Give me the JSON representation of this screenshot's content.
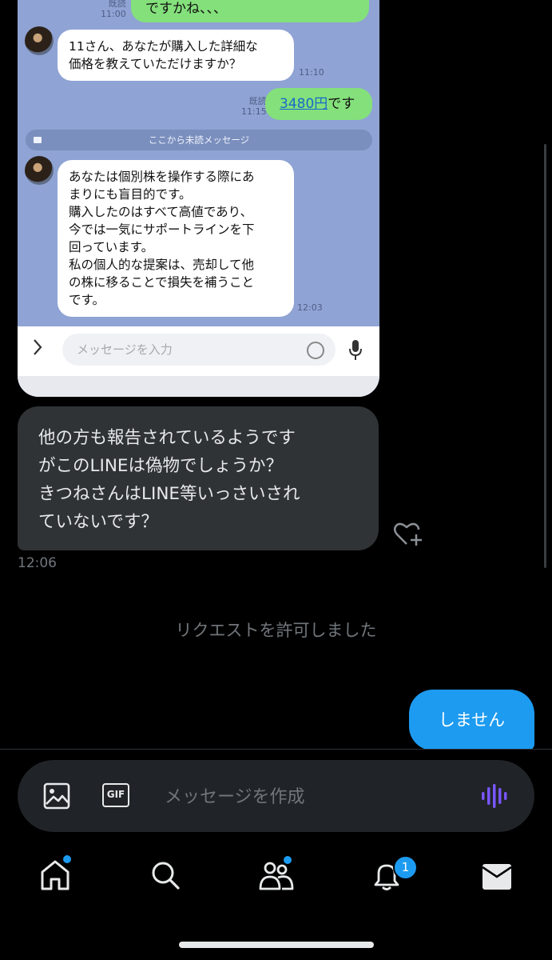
{
  "line_screenshot": {
    "top_bubble": "ですかね、、、",
    "top_read": "既読",
    "top_time": "11:00",
    "question_bubble": [
      "11さん、あなたが購入した詳細な",
      "価格を教えていただけますか？"
    ],
    "question_time": "11:10",
    "reply_read": "既読",
    "reply_time": "11:15",
    "reply_link": "3480円",
    "reply_suffix": "です",
    "unread_divider": "ここから未読メッセージ",
    "advice_bubble": [
      "あなたは個別株を操作する際にあ",
      "まりにも盲目的です。",
      "購入したのはすべて高値であり、",
      "今では一気にサポートラインを下",
      "回っています。",
      "私の個人的な提案は、売却して他",
      "の株に移ることで損失を補うこと",
      "です。"
    ],
    "advice_time": "12:03",
    "input_placeholder": "メッセージを入力"
  },
  "dm": {
    "received_lines": [
      "他の方も報告されているようです",
      "がこのLINEは偽物でしょうか？",
      "きつねさんはLINE等いっさいされ",
      "ていないです？"
    ],
    "received_time": "12:06",
    "system_note": "リクエストを許可しました",
    "sent_message": "しません"
  },
  "composer": {
    "placeholder": "メッセージを作成",
    "gif_label": "GIF"
  },
  "nav": {
    "notifications_badge": "1"
  },
  "colors": {
    "accent": "#1d9bf0",
    "bubble_dark": "#2f3336",
    "line_green": "#84e07b",
    "line_bg": "#8fa3d4",
    "voice_icon": "#7856ff"
  }
}
